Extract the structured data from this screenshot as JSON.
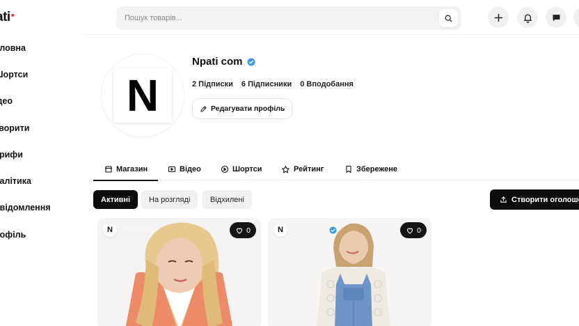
{
  "brand": {
    "logo_text": "ati",
    "accent_color": "#e23b4b"
  },
  "search": {
    "placeholder": "Пошук товарів..."
  },
  "header_actions": [
    "plus-icon",
    "bell-icon",
    "chat-icon"
  ],
  "sidebar": {
    "items": [
      {
        "label": "оловна"
      },
      {
        "label": "Шортси"
      },
      {
        "label": "ідео"
      },
      {
        "label": "творити"
      },
      {
        "label": "арифи"
      },
      {
        "label": "налітика"
      },
      {
        "label": "овідомлення"
      },
      {
        "label": "рофіль"
      }
    ]
  },
  "profile": {
    "avatar_letter": "N",
    "name": "Npati com",
    "verified_color": "#3d9ae8",
    "stats": {
      "following": "2 Підписки",
      "followers": "6 Підписники",
      "likes": "0 Вподобання"
    },
    "edit_label": "Редагувати профіль"
  },
  "tabs": [
    {
      "label": "Магазин",
      "icon": "shop-icon",
      "active": true
    },
    {
      "label": "Відео",
      "icon": "video-icon",
      "active": false
    },
    {
      "label": "Шортси",
      "icon": "play-circle-icon",
      "active": false
    },
    {
      "label": "Рейтинг",
      "icon": "star-icon",
      "active": false
    },
    {
      "label": "Збережене",
      "icon": "bookmark-icon",
      "active": false
    }
  ],
  "filters": {
    "active": "Активні",
    "review": "На розгляді",
    "rejected": "Відхилені"
  },
  "create_listing": {
    "label": "Створити оголошен"
  },
  "cards": [
    {
      "seller_letter": "N",
      "seller_name": "npati.com",
      "likes": "0"
    },
    {
      "seller_letter": "N",
      "seller_name": "",
      "likes": "0"
    }
  ]
}
